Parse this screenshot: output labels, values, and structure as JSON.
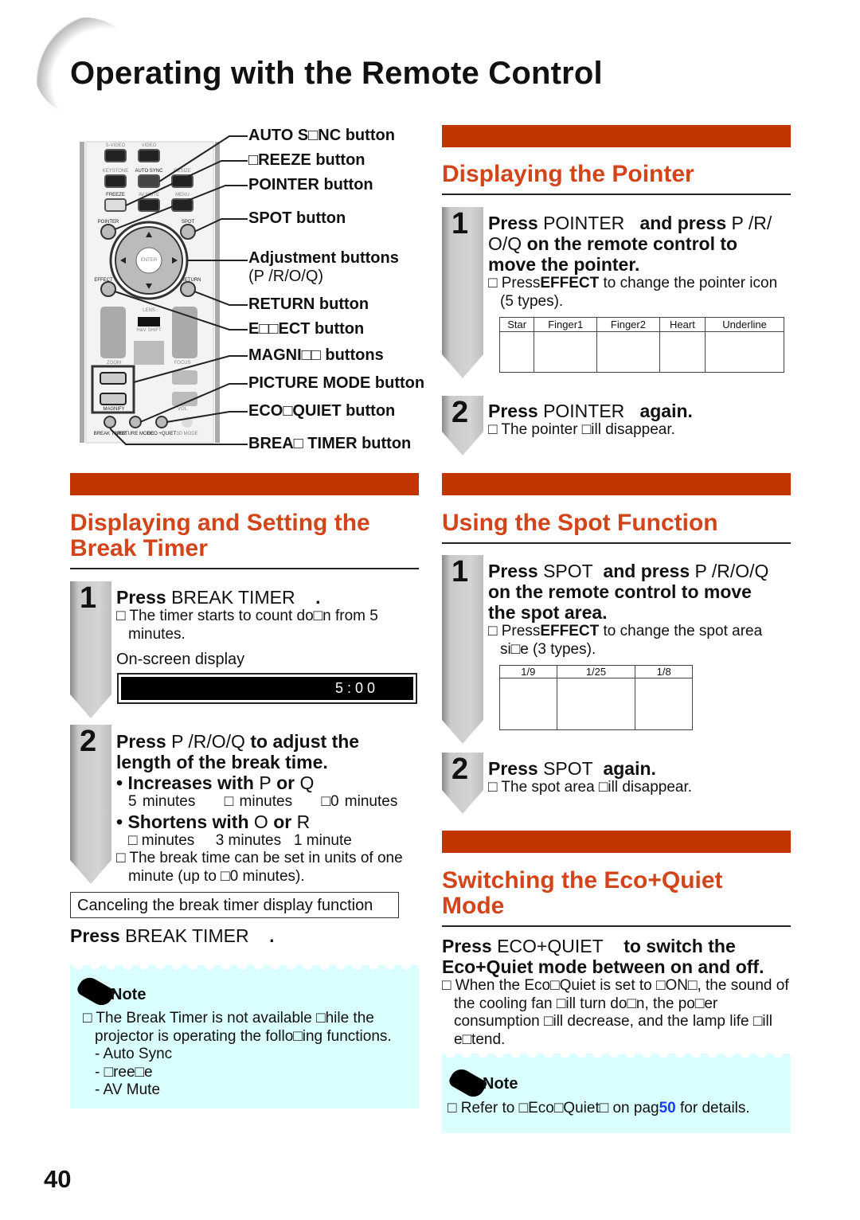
{
  "page": {
    "title": "Operating with the Remote Control",
    "page_number": "40"
  },
  "remote": {
    "labels": [
      "AUTO S□NC button",
      "□REEZE button",
      "POINTER button",
      "SPOT button",
      "Adjustment buttons",
      "(P /R/O/Q)",
      "RETURN button",
      "E□□ECT button",
      "MAGNI□□ buttons",
      "PICTURE MODE button",
      "ECO□QUIET button",
      "BREA□ TIMER button"
    ],
    "keys": {
      "svideo": "S-VIDEO",
      "video": "VIDEO",
      "keystone": "KEYSTONE",
      "autosync": "AUTO SYNC",
      "resize": "RESIZE",
      "freeze": "FREEZE",
      "avmute": "AV MUTE",
      "menu": "MENU",
      "pointer": "POINTER",
      "spot": "SPOT",
      "enter": "ENTER",
      "effect": "EFFECT",
      "return": "RETURN",
      "lens": "LENS",
      "hvshift": "H&V SHIFT",
      "zoom": "ZOOM",
      "focus": "FOCUS",
      "magnify": "MAGNIFY",
      "vol": "VOL",
      "break": "BREAK TIMER",
      "picture": "PICTURE MODE",
      "eco": "ECO +QUIET",
      "mode3d": "3D MODE"
    }
  },
  "pointer": {
    "heading": "Displaying the Pointer",
    "step1": {
      "num": "1",
      "press": "Press",
      "key": "POINTER",
      "mid": "and press",
      "keys": "P /R/",
      "l2keys": "O/Q",
      "l2": "on the remote control to",
      "l3": "move the pointer.",
      "bullet": "□ Press",
      "bold": "EFFECT",
      "rest": "to change the pointer icon",
      "cont": "(5 types)."
    },
    "types": [
      "Star",
      "Finger1",
      "Finger2",
      "Heart",
      "Underline"
    ],
    "step2": {
      "num": "2",
      "press": "Press",
      "key": "POINTER",
      "end": "again.",
      "bullet": "□ The pointer □ill disappear."
    }
  },
  "break": {
    "heading1": "Displaying and Setting the",
    "heading2": "Break Timer",
    "step1": {
      "num": "1",
      "press": "Press",
      "key": "BREAK TIMER",
      "dot": ".",
      "b1": "□ The timer starts to count do□n from 5",
      "b1c": "minutes.",
      "osd_label": "On-screen display",
      "osd_value": "5 : 0 0"
    },
    "step2": {
      "num": "2",
      "press": "Press",
      "keys": "P /R/O/Q",
      "l1": "to adjust the",
      "l2": "length of the break time.",
      "inc": "Increases with",
      "inc_k1": "P",
      "or": "or",
      "inc_k2": "Q",
      "inc_vals": [
        "5 minutes",
        "□ minutes",
        "□0 minutes"
      ],
      "sho": "Shortens with",
      "sho_k1": "O",
      "sho_k2": "R",
      "sho_vals": [
        "□ minutes",
        "3 minutes",
        "1 minute"
      ],
      "b": "□ The break time can be set in units of one",
      "bc": "minute (up to □0 minutes)."
    },
    "cancel_box": "Canceling the break timer display function",
    "cancel": {
      "press": "Press",
      "key": "BREAK TIMER",
      "dot": "."
    },
    "note": {
      "title": "Note",
      "l1": "□ The Break Timer is not available □hile the",
      "l2": "projector is operating the follo□ing functions.",
      "items": [
        "- Auto Sync",
        "- □ree□e",
        "- AV Mute"
      ]
    }
  },
  "spot": {
    "heading": "Using the Spot Function",
    "step1": {
      "num": "1",
      "press": "Press",
      "key": "SPOT",
      "mid": "and press",
      "keys": "P /R/O/Q",
      "l2": "on the remote control to move",
      "l3": "the spot area.",
      "bullet": "□ Press",
      "bold": "EFFECT",
      "rest": "to change the spot area",
      "cont": "si□e (3 types)."
    },
    "sizes": [
      "1/9",
      "1/25",
      "1/8"
    ],
    "step2": {
      "num": "2",
      "press": "Press",
      "key": "SPOT",
      "end": "again.",
      "bullet": "□ The spot area □ill disappear."
    }
  },
  "eco": {
    "heading1": "Switching the Eco+Quiet",
    "heading2": "Mode",
    "press": "Press",
    "key": "ECO+QUIET",
    "l1": "to switch the",
    "l2": "Eco+Quiet mode between on and off.",
    "b": "□ When the Eco□Quiet is set to □ON□, the sound of",
    "b2": "the cooling fan □ill turn do□n, the po□er",
    "b3": "consumption □ill decrease, and the lamp life □ill",
    "b4": "e□tend.",
    "note": {
      "title": "Note",
      "pre": "□ Refer to □Eco□Quiet□ on pag",
      "page_link": "50",
      "post": "for details."
    }
  },
  "colors": {
    "accent_bar": "#c23400",
    "heading": "#d2451a",
    "note_bg": "#d9ffff",
    "link": "#1a3cff"
  }
}
